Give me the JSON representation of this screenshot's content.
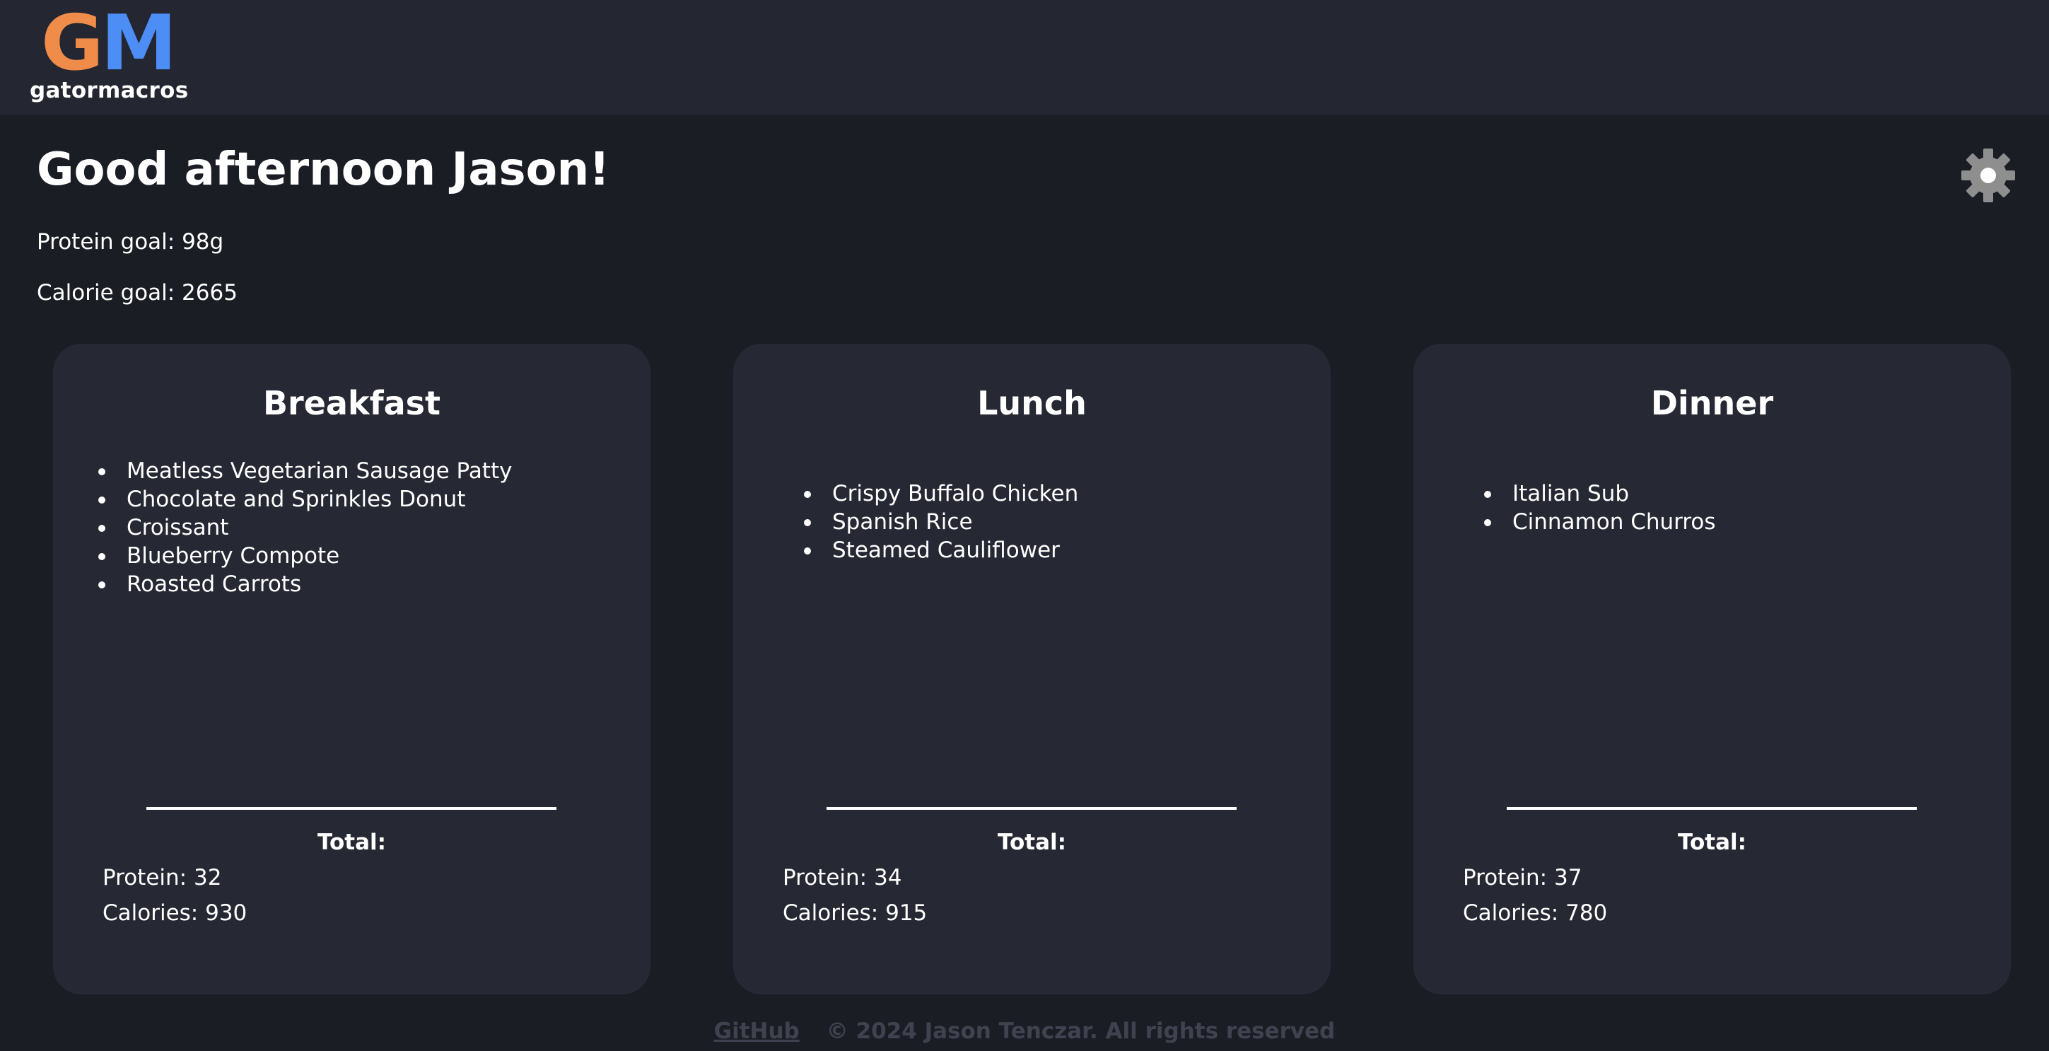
{
  "header": {
    "logo_letter_g": "G",
    "logo_letter_m": "M",
    "logo_wordmark": "gatormacros",
    "colors": {
      "g": "#f08c4a",
      "m": "#4d8ef6"
    }
  },
  "greeting": "Good afternoon Jason!",
  "goals": {
    "protein": "Protein goal: 98g",
    "calorie": "Calorie goal: 2665"
  },
  "settings_icon": "gear-icon",
  "meals": [
    {
      "title": "Breakfast",
      "items": [
        "Meatless Vegetarian Sausage Patty",
        "Chocolate and Sprinkles Donut",
        "Croissant",
        "Blueberry Compote",
        "Roasted Carrots"
      ],
      "total_label": "Total:",
      "protein": "Protein: 32",
      "calories": "Calories: 930"
    },
    {
      "title": "Lunch",
      "items": [
        "Crispy Buffalo Chicken",
        "Spanish Rice",
        "Steamed Cauliflower"
      ],
      "total_label": "Total:",
      "protein": "Protein: 34",
      "calories": "Calories: 915"
    },
    {
      "title": "Dinner",
      "items": [
        "Italian Sub",
        "Cinnamon Churros"
      ],
      "total_label": "Total:",
      "protein": "Protein: 37",
      "calories": "Calories: 780"
    }
  ],
  "footer": {
    "github_link": "GitHub",
    "copyright": "© 2024 Jason Tenczar. All rights reserved"
  }
}
